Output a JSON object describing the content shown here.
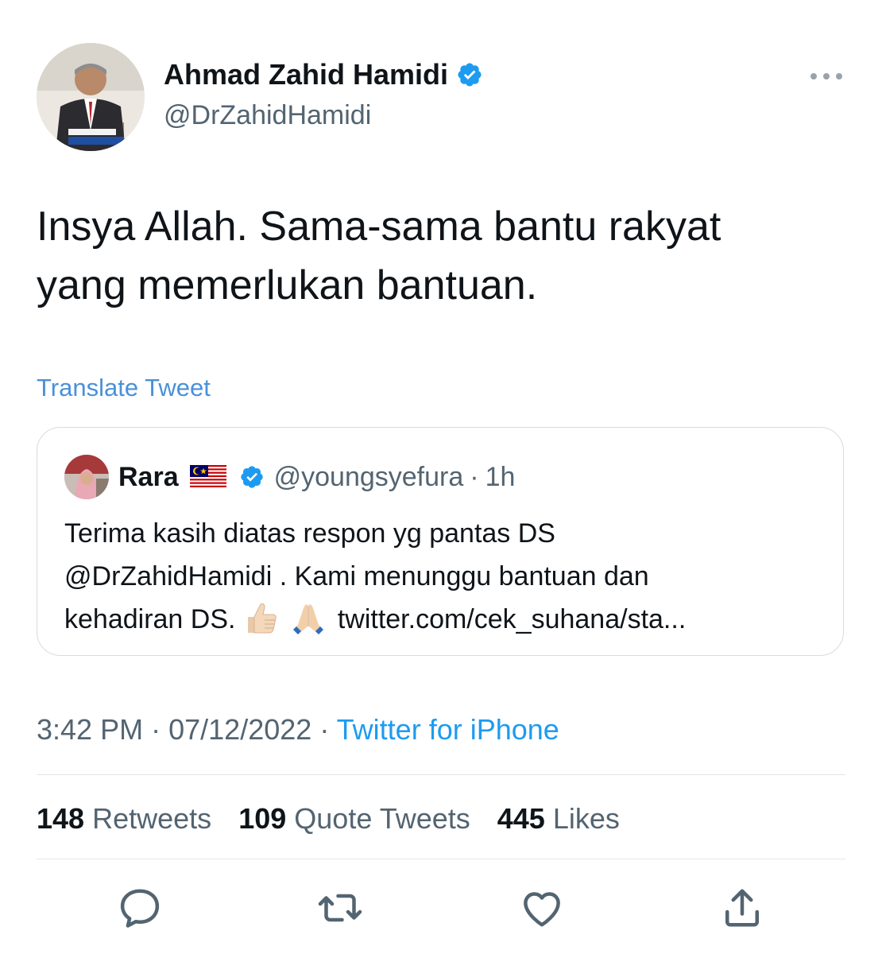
{
  "tweet": {
    "author": {
      "display_name": "Ahmad Zahid Hamidi",
      "handle": "@DrZahidHamidi",
      "verified": true
    },
    "text": "Insya Allah. Sama-sama bantu rakyat\nyang memerlukan bantuan.",
    "translate_label": "Translate Tweet",
    "quoted": {
      "display_name": "Rara",
      "handle": "@youngsyefura",
      "separator": "·",
      "age": "1h",
      "text_line1": "Terima kasih diatas respon yg pantas DS",
      "text_line2": "@DrZahidHamidi . Kami menunggu bantuan dan",
      "text_line3_prefix": "kehadiran DS.",
      "link": "twitter.com/cek_suhana/sta..."
    },
    "time": "3:42 PM",
    "separator": "·",
    "date": "07/12/2022",
    "source": "Twitter for iPhone",
    "stats": {
      "retweets": "148",
      "retweets_label": "Retweets",
      "quote_tweets": "109",
      "quote_tweets_label": "Quote Tweets",
      "likes": "445",
      "likes_label": "Likes"
    }
  },
  "colors": {
    "link": "#1d9bf0",
    "translate": "#4a90d9",
    "secondary_text": "#536471",
    "primary_text": "#0f1419",
    "verified": "#1d9bf0"
  },
  "icons": [
    "more-icon",
    "verified-icon",
    "flag-malaysia-icon",
    "thumbs-up-emoji",
    "folded-hands-emoji",
    "reply-icon",
    "retweet-icon",
    "like-icon",
    "share-icon"
  ]
}
